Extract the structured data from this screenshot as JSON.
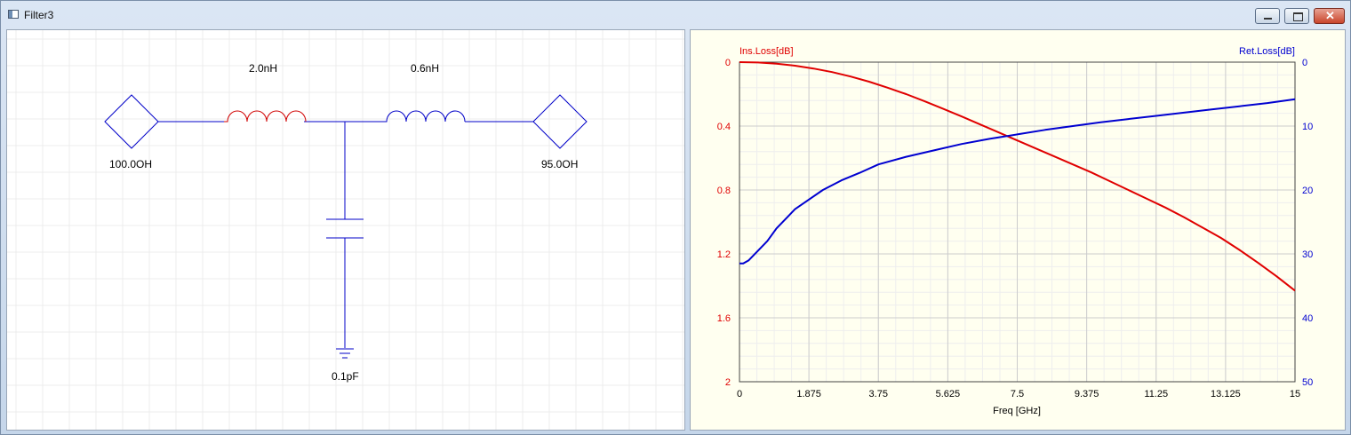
{
  "window": {
    "title": "Filter3"
  },
  "schematic": {
    "inductor1_label": "2.0nH",
    "inductor2_label": "0.6nH",
    "port1_label": "100.0OH",
    "port2_label": "95.0OH",
    "capacitor_label": "0.1pF",
    "colors": {
      "wire": "#0000c8",
      "inductor": "#d00000"
    }
  },
  "chart_data": {
    "type": "line",
    "title": "",
    "xlabel": "Freq [GHz]",
    "ylabel_left": "Ins.Loss[dB]",
    "ylabel_right": "Ret.Loss[dB]",
    "xlim": [
      0,
      15
    ],
    "ylim_left": [
      0,
      2
    ],
    "ylim_right": [
      0,
      50
    ],
    "y_left_inverted": true,
    "y_right_inverted": true,
    "x_ticks": [
      "0",
      "1.875",
      "3.75",
      "5.625",
      "7.5",
      "9.375",
      "11.25",
      "13.125",
      "15"
    ],
    "y_left_ticks": [
      "0",
      "0.4",
      "0.8",
      "1.2",
      "1.6",
      "2"
    ],
    "y_right_ticks": [
      "0",
      "10",
      "20",
      "30",
      "40",
      "50"
    ],
    "grid": true,
    "series": [
      {
        "name": "Ins.Loss[dB]",
        "axis": "left",
        "color": "#e00000",
        "x": [
          0,
          0.5,
          1,
          1.5,
          2,
          2.5,
          3,
          3.5,
          4,
          4.5,
          5,
          5.5,
          6,
          6.5,
          7,
          7.5,
          8,
          8.5,
          9,
          9.5,
          10,
          10.5,
          11,
          11.5,
          12,
          12.5,
          13,
          13.5,
          14,
          14.5,
          15
        ],
        "y": [
          0,
          0.002,
          0.01,
          0.022,
          0.04,
          0.062,
          0.09,
          0.122,
          0.16,
          0.2,
          0.245,
          0.292,
          0.34,
          0.39,
          0.44,
          0.49,
          0.54,
          0.59,
          0.64,
          0.69,
          0.745,
          0.8,
          0.855,
          0.91,
          0.97,
          1.035,
          1.1,
          1.175,
          1.255,
          1.34,
          1.43
        ]
      },
      {
        "name": "Ret.Loss[dB]",
        "axis": "right",
        "color": "#0000d0",
        "x": [
          0,
          0.1,
          0.25,
          0.5,
          0.75,
          1,
          1.25,
          1.5,
          1.875,
          2.25,
          2.75,
          3.25,
          3.75,
          4.5,
          5.25,
          6,
          6.75,
          7.5,
          8.25,
          9,
          9.75,
          10.5,
          11.25,
          12,
          12.75,
          13.5,
          14.25,
          15
        ],
        "y": [
          31.5,
          31.5,
          31.0,
          29.5,
          28.0,
          26.0,
          24.5,
          23.0,
          21.5,
          20.0,
          18.5,
          17.3,
          16.0,
          14.8,
          13.8,
          12.8,
          12.0,
          11.3,
          10.6,
          10.0,
          9.4,
          8.9,
          8.4,
          7.9,
          7.4,
          6.9,
          6.4,
          5.8
        ]
      }
    ]
  }
}
